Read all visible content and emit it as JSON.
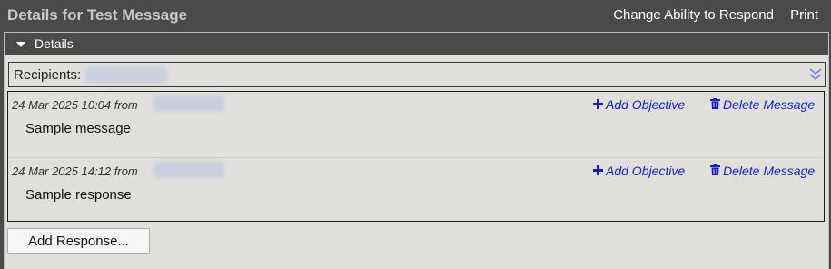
{
  "header": {
    "title": "Details for Test Message",
    "change_ability_label": "Change Ability to Respond",
    "print_label": "Print"
  },
  "details_panel": {
    "title": "Details",
    "recipients_label": "Recipients:"
  },
  "messages": [
    {
      "meta": "24 Mar 2025 10:04 from",
      "body": "Sample message",
      "add_objective_label": "Add Objective",
      "delete_label": "Delete Message"
    },
    {
      "meta": "24 Mar 2025 14:12 from",
      "body": "Sample response",
      "add_objective_label": "Add Objective",
      "delete_label": "Delete Message"
    }
  ],
  "actions": {
    "add_response_label": "Add Response..."
  },
  "icons": {
    "add": "plus-icon",
    "delete": "trash-icon",
    "collapse": "caret-down-icon",
    "expand": "double-chevron-down-icon"
  },
  "colors": {
    "header_bg": "#4a4a4a",
    "panel_bg": "#e1dfdb",
    "link_blue": "#1a1acc"
  }
}
